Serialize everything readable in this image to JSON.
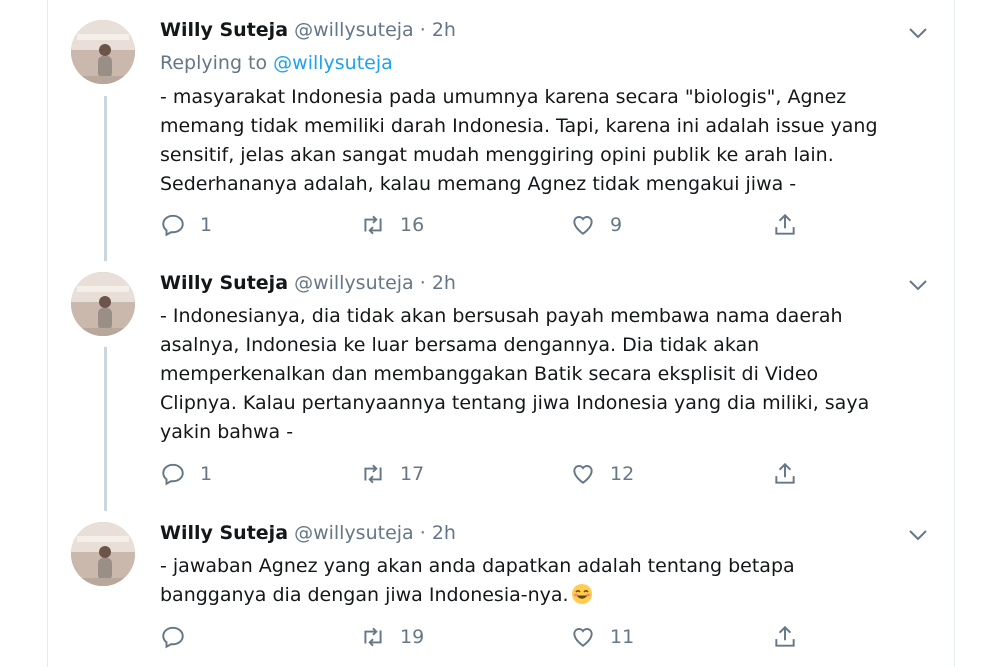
{
  "tweets": [
    {
      "name": "Willy Suteja",
      "handle": "@willysuteja",
      "separator": "·",
      "time": "2h",
      "reply_prefix": "Replying to ",
      "reply_to": "@willysuteja",
      "text": "- masyarakat Indonesia pada umumnya karena secara \"biologis\", Agnez\nmemang tidak memiliki darah Indonesia. Tapi, karena ini adalah issue yang\nsensitif, jelas akan sangat mudah menggiring opini publik ke arah lain.\nSederhananya adalah, kalau memang Agnez tidak mengakui jiwa -",
      "replies": "1",
      "retweets": "16",
      "likes": "9"
    },
    {
      "name": "Willy Suteja",
      "handle": "@willysuteja",
      "separator": "·",
      "time": "2h",
      "text": "- Indonesianya, dia tidak akan bersusah payah membawa nama daerah\nasalnya, Indonesia ke luar bersama dengannya. Dia tidak akan\nmemperkenalkan dan membanggakan Batik secara eksplisit di Video\nClipnya. Kalau pertanyaannya tentang jiwa Indonesia yang dia miliki, saya\nyakin bahwa -",
      "replies": "1",
      "retweets": "17",
      "likes": "12"
    },
    {
      "name": "Willy Suteja",
      "handle": "@willysuteja",
      "separator": "·",
      "time": "2h",
      "text": "- jawaban Agnez yang akan anda dapatkan adalah tentang betapa\nbangganya dia dengan jiwa Indonesia-nya.",
      "replies": "",
      "retweets": "19",
      "likes": "11"
    }
  ],
  "icons": {
    "avatar": "avatar",
    "more": "chevron-down-icon",
    "reply": "reply-icon",
    "retweet": "retweet-icon",
    "like": "heart-icon",
    "share": "share-icon",
    "emoji": "smiling-face-emoji"
  },
  "colors": {
    "text": "#14171a",
    "muted": "#657786",
    "link": "#1da1f2",
    "thread_line": "#ccd6dd"
  }
}
